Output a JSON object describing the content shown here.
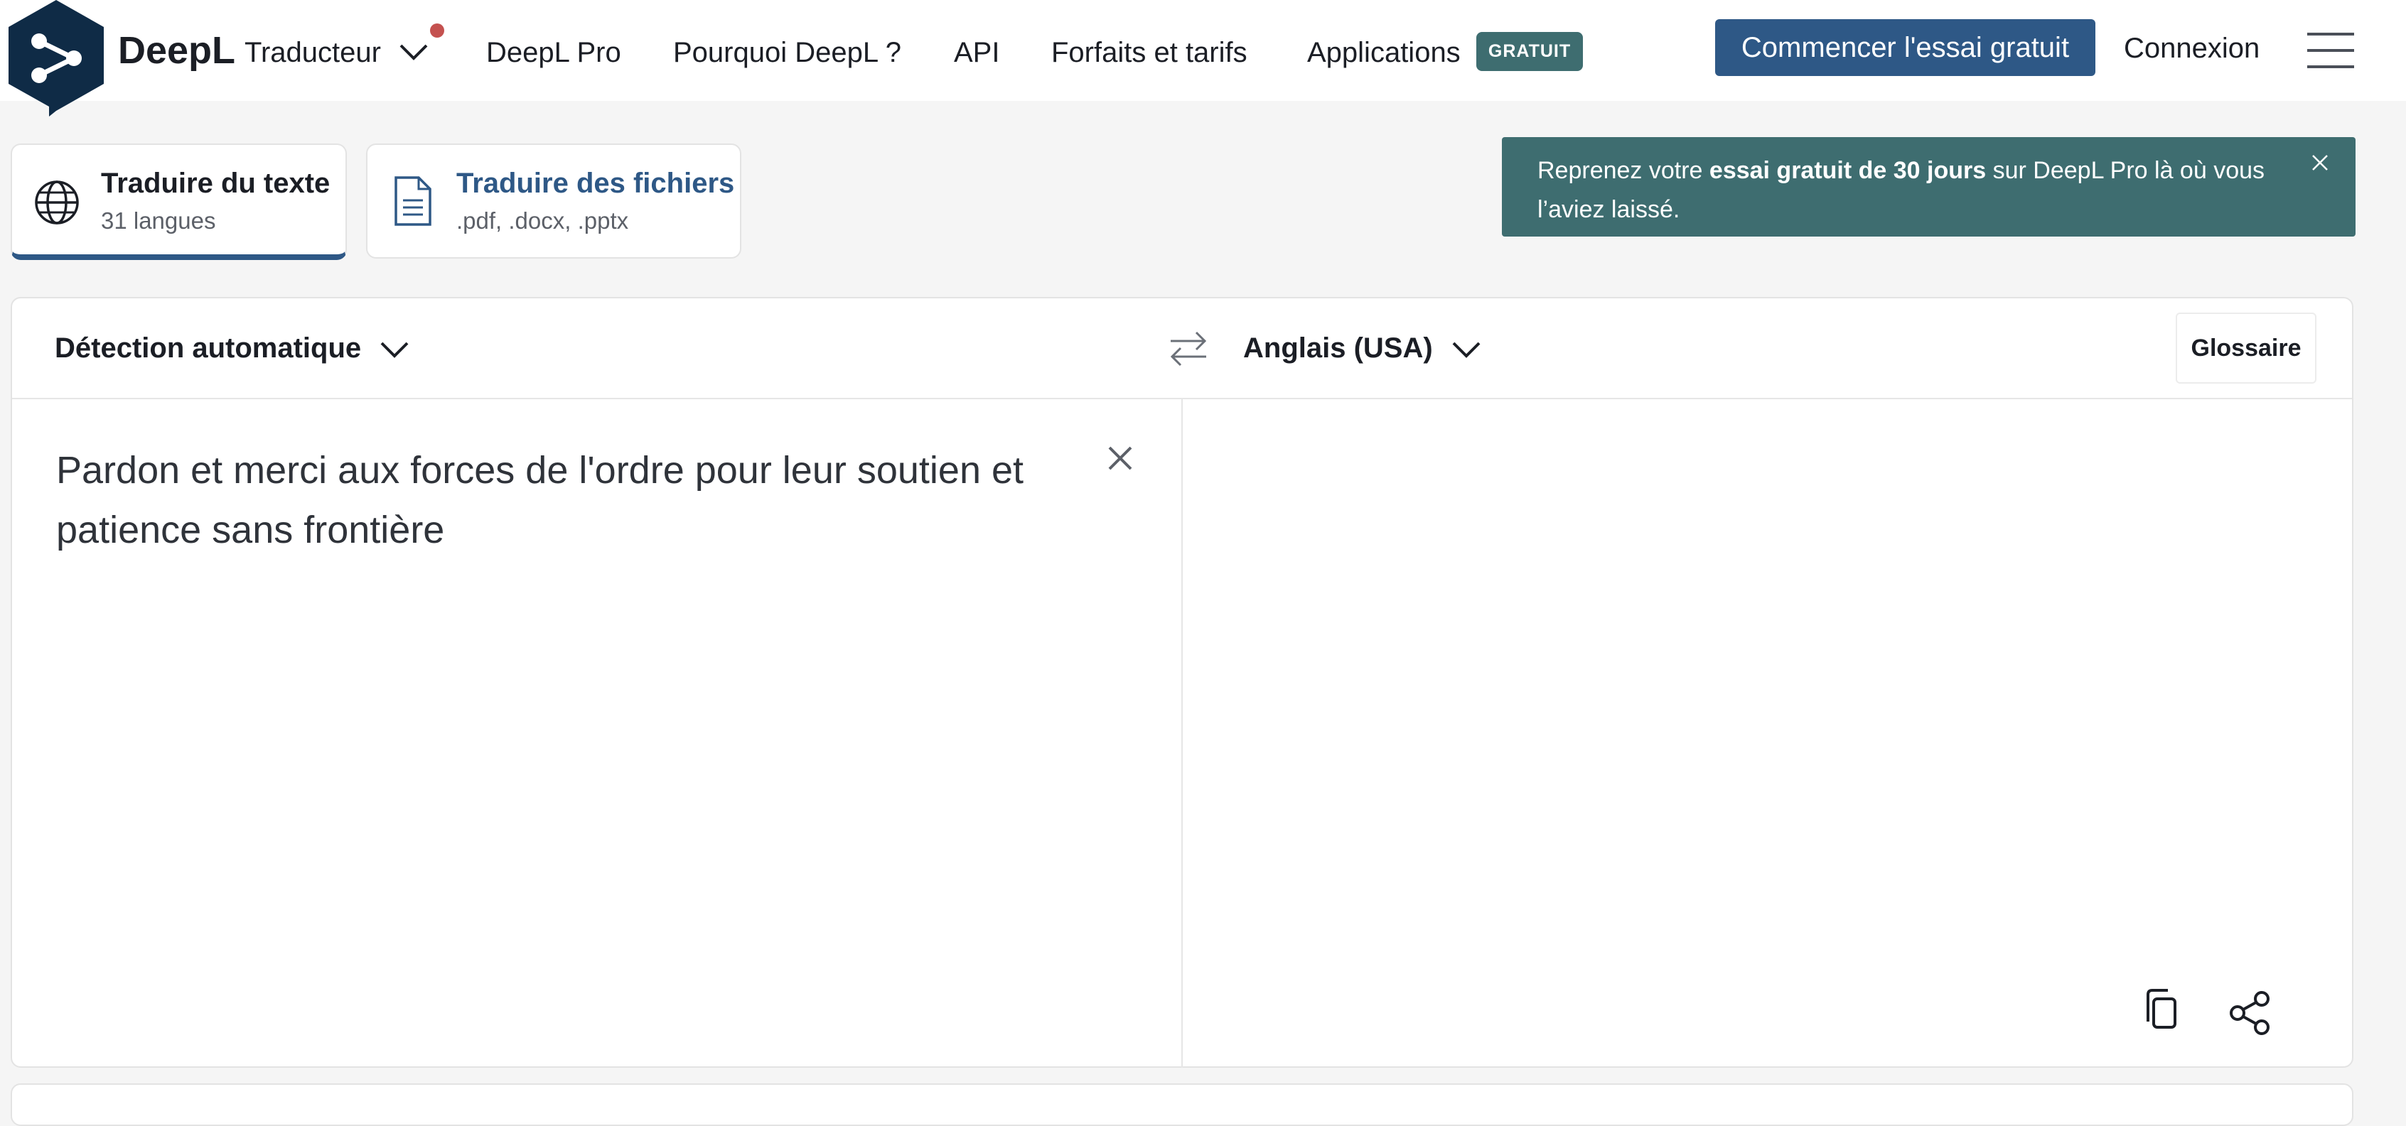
{
  "header": {
    "brand": "DeepL",
    "product": "Traducteur",
    "nav": [
      "DeepL Pro",
      "Pourquoi DeepL ?",
      "API",
      "Forfaits et tarifs",
      "Applications"
    ],
    "badge": "GRATUIT",
    "cta": "Commencer l'essai gratuit",
    "login": "Connexion"
  },
  "tabs": [
    {
      "title": "Traduire du texte",
      "sub": "31 langues"
    },
    {
      "title": "Traduire des fichiers",
      "sub": ".pdf, .docx, .pptx"
    }
  ],
  "toast": {
    "pre": "Reprenez votre ",
    "bold": "essai gratuit de 30 jours",
    "post": " sur DeepL Pro là où vous l’aviez laissé."
  },
  "translator": {
    "source_lang": "Détection automatique",
    "target_lang": "Anglais (USA)",
    "glossary": "Glossaire",
    "source_text": "Pardon et merci aux forces de l'ordre pour leur soutien et patience sans frontière"
  },
  "colors": {
    "primary": "#2e5886",
    "accent": "#3e6d70",
    "brand_dark": "#0f2b46",
    "dot": "#c4514f"
  },
  "icons": [
    "deepl-logo-icon",
    "chevron-down-icon",
    "globe-icon",
    "document-icon",
    "close-icon",
    "swap-icon",
    "copy-icon",
    "share-icon",
    "hamburger-icon"
  ]
}
